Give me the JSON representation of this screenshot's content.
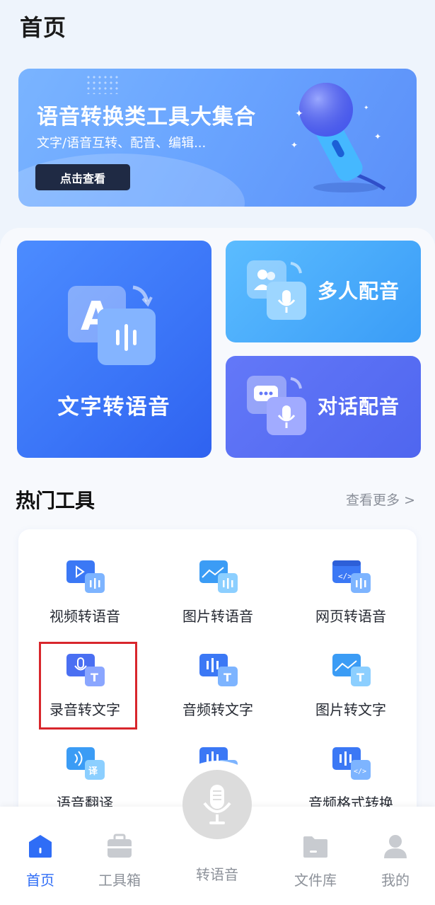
{
  "page": {
    "title": "首页"
  },
  "banner": {
    "title": "语音转换类工具大集合",
    "subtitle": "文字/语音互转、配音、编辑...",
    "button": "点击查看"
  },
  "features": {
    "main": "文字转语音",
    "multi_dub": "多人配音",
    "dialog_dub": "对话配音"
  },
  "hot_tools": {
    "title": "热门工具",
    "more": "查看更多 >",
    "items": [
      {
        "label": "视频转语音",
        "icon": "video-to-audio-icon"
      },
      {
        "label": "图片转语音",
        "icon": "image-to-audio-icon"
      },
      {
        "label": "网页转语音",
        "icon": "webpage-to-audio-icon"
      },
      {
        "label": "录音转文字",
        "icon": "recording-to-text-icon"
      },
      {
        "label": "音频转文字",
        "icon": "audio-to-text-icon"
      },
      {
        "label": "图片转文字",
        "icon": "image-to-text-icon"
      },
      {
        "label": "语音翻译",
        "icon": "voice-translate-icon"
      },
      {
        "label": "",
        "icon": "audio-crop-icon"
      },
      {
        "label": "音频格式转换",
        "icon": "audio-format-icon"
      }
    ]
  },
  "nav": {
    "home": "首页",
    "toolbox": "工具箱",
    "center": "转语音",
    "files": "文件库",
    "mine": "我的"
  },
  "colors": {
    "accent": "#2f6df6",
    "highlight": "#d8262c"
  }
}
